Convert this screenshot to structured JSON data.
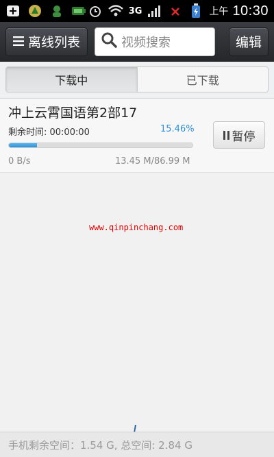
{
  "statusbar": {
    "icons": [
      "add-box-icon",
      "app-icon",
      "user-icon",
      "battery-small-icon",
      "alarm-icon",
      "wifi-icon"
    ],
    "network": "3G",
    "ampm": "上午",
    "time": "10:30"
  },
  "toolbar": {
    "list_label": "离线列表",
    "search_placeholder": "视频搜索",
    "edit_label": "编辑"
  },
  "tabs": {
    "downloading": "下载中",
    "downloaded": "已下载"
  },
  "download": {
    "title": "冲上云霄国语第2部17",
    "remaining": "剩余时间: 00:00:00",
    "percent": "15.46%",
    "progress": 0.1546,
    "speed": "0 B/s",
    "size": "13.45 M/86.99 M",
    "pause_label": "暂停"
  },
  "watermark": "www.qinpinchang.com",
  "footer": {
    "storage": "手机剩余空间：1.54 G, 总空间: 2.84 G"
  },
  "colors": {
    "accent": "#2e8fd8",
    "watermark": "#e60000"
  }
}
